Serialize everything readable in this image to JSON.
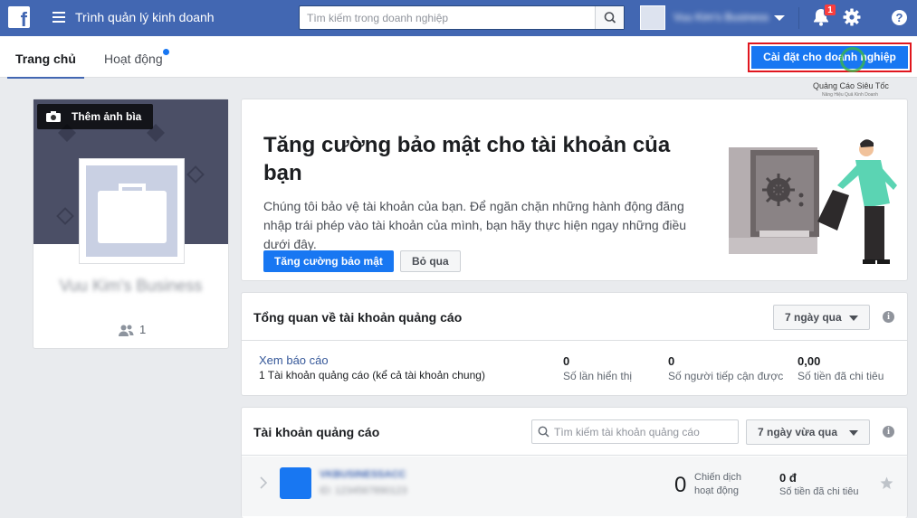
{
  "topbar": {
    "logo": "f",
    "app_title": "Trình quản lý kinh doanh",
    "search_placeholder": "Tìm kiếm trong doanh nghiệp",
    "account_name": "Vuu Kim's Business",
    "notification_count": "1",
    "help_label": "?",
    "bg_color": "#4267b2"
  },
  "subnav": {
    "tabs": [
      {
        "label": "Trang chủ",
        "active": true
      },
      {
        "label": "Hoạt động",
        "active": false
      }
    ],
    "setup_button": "Cài đặt cho doanh nghiệp",
    "watermark_text": "Quảng Cáo Siêu Tốc",
    "watermark_sub": "Nâng Hiệu Quả Kinh Doanh"
  },
  "profile": {
    "cover_button": "Thêm ảnh bìa",
    "business_name": "Vuu Kim's Business",
    "member_count": "1"
  },
  "security": {
    "title": "Tăng cường bảo mật cho tài khoản của bạn",
    "body": "Chúng tôi bảo vệ tài khoản của bạn. Để ngăn chặn những hành động đăng nhập trái phép vào tài khoản của mình, bạn hãy thực hiện ngay những điều dưới đây.",
    "primary_button": "Tăng cường bảo mật",
    "secondary_button": "Bỏ qua"
  },
  "overview": {
    "title": "Tổng quan về tài khoản quảng cáo",
    "range": "7 ngày qua",
    "view_report": "Xem báo cáo",
    "subtitle": "1 Tài khoản quảng cáo (kể cả tài khoản chung)",
    "stats": [
      {
        "value": "0",
        "label": "Số lần hiển thị"
      },
      {
        "value": "0",
        "label": "Số người tiếp cận được"
      },
      {
        "value": "0,00",
        "label": "Số tiền đã chi tiêu"
      }
    ]
  },
  "accounts": {
    "title": "Tài khoản quảng cáo",
    "search_placeholder": "Tìm kiếm tài khoản quảng cáo",
    "range": "7 ngày vừa qua",
    "rows": [
      {
        "name": "VKBUSINESSACC",
        "id": "ID: 1234567890123",
        "campaigns": "0",
        "campaigns_label": "Chiến dịch hoạt động",
        "spend": "0 đ",
        "spend_label": "Số tiền đã chi tiêu"
      }
    ]
  }
}
